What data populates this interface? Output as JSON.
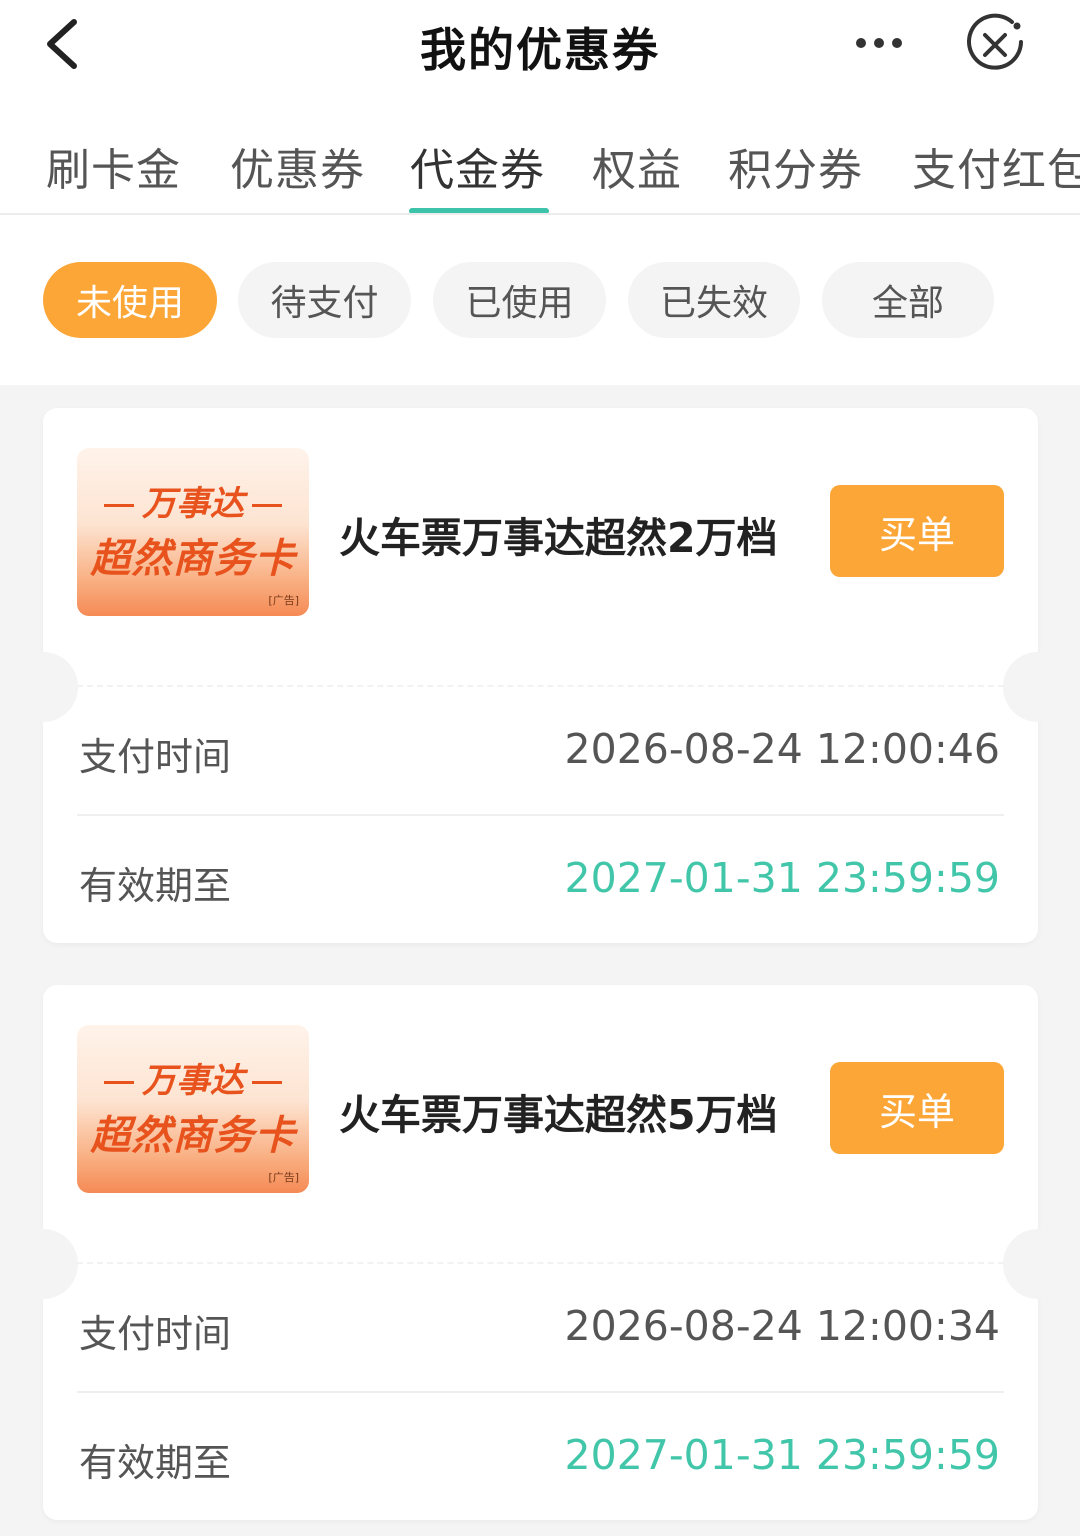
{
  "header": {
    "title": "我的优惠券",
    "back_icon": "chevron-left-icon",
    "more_icon": "more-dots-icon",
    "close_icon": "close-circle-icon"
  },
  "tabs": [
    {
      "label": "刷卡金",
      "active": false
    },
    {
      "label": "优惠券",
      "active": false
    },
    {
      "label": "代金券",
      "active": true
    },
    {
      "label": "权益",
      "active": false
    },
    {
      "label": "积分券",
      "active": false
    },
    {
      "label": "支付红包",
      "active": false
    }
  ],
  "filters": [
    {
      "label": "未使用",
      "active": true
    },
    {
      "label": "待支付",
      "active": false
    },
    {
      "label": "已使用",
      "active": false
    },
    {
      "label": "已失效",
      "active": false
    },
    {
      "label": "全部",
      "active": false
    }
  ],
  "colors": {
    "accent_orange": "#fba637",
    "accent_green": "#3cc3a9",
    "background": "#f4f4f4"
  },
  "coupons": [
    {
      "thumb_line1": "万事达",
      "thumb_line2": "超然商务卡",
      "thumb_ad": "[广告]",
      "title": "火车票万事达超然2万档",
      "button": "买单",
      "pay_time_label": "支付时间",
      "pay_time_value": "2026-08-24 12:00:46",
      "expire_label": "有效期至",
      "expire_value": "2027-01-31 23:59:59"
    },
    {
      "thumb_line1": "万事达",
      "thumb_line2": "超然商务卡",
      "thumb_ad": "[广告]",
      "title": "火车票万事达超然5万档",
      "button": "买单",
      "pay_time_label": "支付时间",
      "pay_time_value": "2026-08-24 12:00:34",
      "expire_label": "有效期至",
      "expire_value": "2027-01-31 23:59:59"
    }
  ]
}
